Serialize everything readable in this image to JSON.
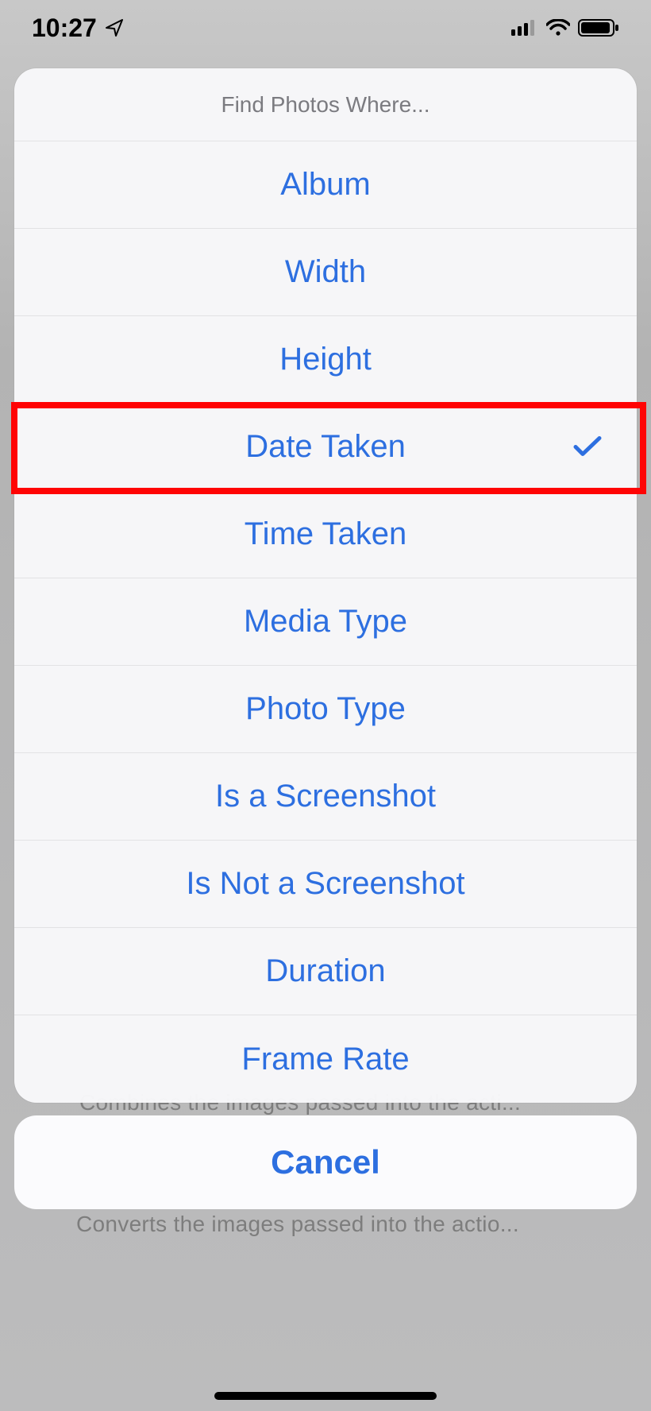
{
  "status": {
    "time": "10:27"
  },
  "sheet": {
    "title": "Find Photos Where...",
    "options": [
      {
        "label": "Album",
        "selected": false
      },
      {
        "label": "Width",
        "selected": false
      },
      {
        "label": "Height",
        "selected": false
      },
      {
        "label": "Date Taken",
        "selected": true
      },
      {
        "label": "Time Taken",
        "selected": false
      },
      {
        "label": "Media Type",
        "selected": false
      },
      {
        "label": "Photo Type",
        "selected": false
      },
      {
        "label": "Is a Screenshot",
        "selected": false
      },
      {
        "label": "Is Not a Screenshot",
        "selected": false
      },
      {
        "label": "Duration",
        "selected": false
      },
      {
        "label": "Frame Rate",
        "selected": false
      }
    ],
    "cancel": "Cancel"
  },
  "background": {
    "hint1": "Combines the images passed into the acti...",
    "hint2": "Converts the images passed into the actio..."
  },
  "highlight": {
    "option_index": 3
  }
}
